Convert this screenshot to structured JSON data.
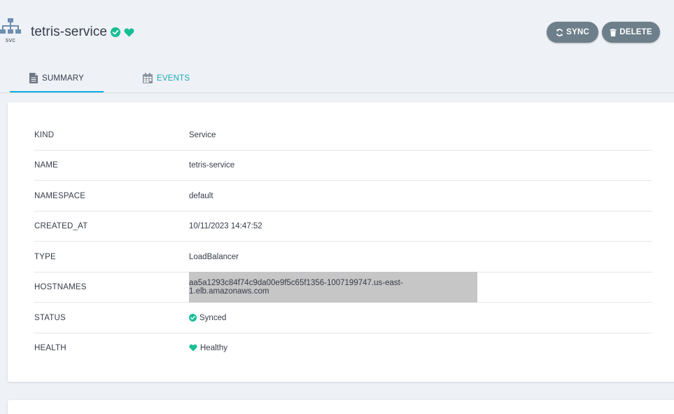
{
  "header": {
    "icon_label": "svc",
    "title": "tetris-service",
    "sync_label": "SYNC",
    "delete_label": "DELETE"
  },
  "tabs": [
    {
      "label": "SUMMARY",
      "active": true
    },
    {
      "label": "EVENTS",
      "active": false
    }
  ],
  "summary": {
    "rows": [
      {
        "key": "KIND",
        "value": "Service"
      },
      {
        "key": "NAME",
        "value": "tetris-service"
      },
      {
        "key": "NAMESPACE",
        "value": "default"
      },
      {
        "key": "CREATED_AT",
        "value": "10/11/2023 14:47:52"
      },
      {
        "key": "TYPE",
        "value": "LoadBalancer"
      },
      {
        "key": "HOSTNAMES",
        "value": "aa5a1293c84f74c9da00e9f5c65f1356-1007199747.us-east-1.elb.amazonaws.com"
      },
      {
        "key": "STATUS",
        "value": "Synced"
      },
      {
        "key": "HEALTH",
        "value": "Healthy"
      }
    ]
  },
  "colors": {
    "status_green": "#18be94",
    "button_bg": "#6d7f8b",
    "tab_active_underline": "#0dadea",
    "tab_inactive_text": "#19aab7"
  }
}
